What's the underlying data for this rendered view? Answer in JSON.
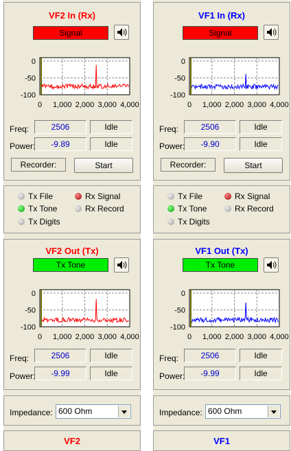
{
  "colors": {
    "left_accent": "#ff0000",
    "right_accent": "#0000ff",
    "rx_bar": "#ff0000",
    "tx_bar": "#00ee00"
  },
  "left": {
    "rx": {
      "title": "VF2 In (Rx)",
      "signal": "Signal",
      "freq": "2506",
      "freq_status": "Idle",
      "power": "-9.89",
      "power_status": "Idle",
      "recorder": "Recorder:",
      "start": "Start"
    },
    "indicators": {
      "tx_file": "Tx File",
      "rx_signal": "Rx Signal",
      "tx_tone": "Tx Tone",
      "rx_record": "Rx Record",
      "tx_digits": "Tx Digits"
    },
    "tx": {
      "title": "VF2 Out (Tx)",
      "signal": "Tx Tone",
      "freq": "2506",
      "freq_status": "Idle",
      "power": "-9.99",
      "power_status": "Idle"
    },
    "impedance": {
      "label": "Impedance:",
      "value": "600 Ohm"
    },
    "footer": "VF2"
  },
  "right": {
    "rx": {
      "title": "VF1 In (Rx)",
      "signal": "Signal",
      "freq": "2506",
      "freq_status": "Idle",
      "power": "-9.90",
      "power_status": "Idle",
      "recorder": "Recorder:",
      "start": "Start"
    },
    "indicators": {
      "tx_file": "Tx File",
      "rx_signal": "Rx Signal",
      "tx_tone": "Tx Tone",
      "rx_record": "Rx Record",
      "tx_digits": "Tx Digits"
    },
    "tx": {
      "title": "VF1 Out (Tx)",
      "signal": "Tx Tone",
      "freq": "2506",
      "freq_status": "Idle",
      "power": "-9.99",
      "power_status": "Idle"
    },
    "impedance": {
      "label": "Impedance:",
      "value": "600 Ohm"
    },
    "footer": "VF1"
  },
  "labels": {
    "freq": "Freq:",
    "power": "Power:"
  },
  "spectrum_axes": {
    "y_ticks": [
      "0",
      "-50",
      "-100"
    ],
    "x_ticks": [
      "0",
      "1,000",
      "2,000",
      "3,000",
      "4,000"
    ]
  },
  "chart_data": [
    {
      "type": "line",
      "name_ref": "VF2 In (Rx)",
      "color": "#ff0000",
      "xlim": [
        0,
        4000
      ],
      "ylim": [
        -100,
        10
      ],
      "baseline": -75,
      "peak": {
        "x": 2506,
        "y": -12
      }
    },
    {
      "type": "line",
      "name_ref": "VF1 In (Rx)",
      "color": "#0000ff",
      "xlim": [
        0,
        4000
      ],
      "ylim": [
        -100,
        10
      ],
      "baseline": -76,
      "peak": {
        "x": 2506,
        "y": -38
      }
    },
    {
      "type": "line",
      "name_ref": "VF2 Out (Tx)",
      "color": "#ff0000",
      "xlim": [
        0,
        4000
      ],
      "ylim": [
        -100,
        10
      ],
      "baseline": -80,
      "peak": {
        "x": 2506,
        "y": -18
      }
    },
    {
      "type": "line",
      "name_ref": "VF1 Out (Tx)",
      "color": "#0000ff",
      "xlim": [
        0,
        4000
      ],
      "ylim": [
        -100,
        10
      ],
      "baseline": -80,
      "peak": {
        "x": 2506,
        "y": -28
      }
    }
  ]
}
